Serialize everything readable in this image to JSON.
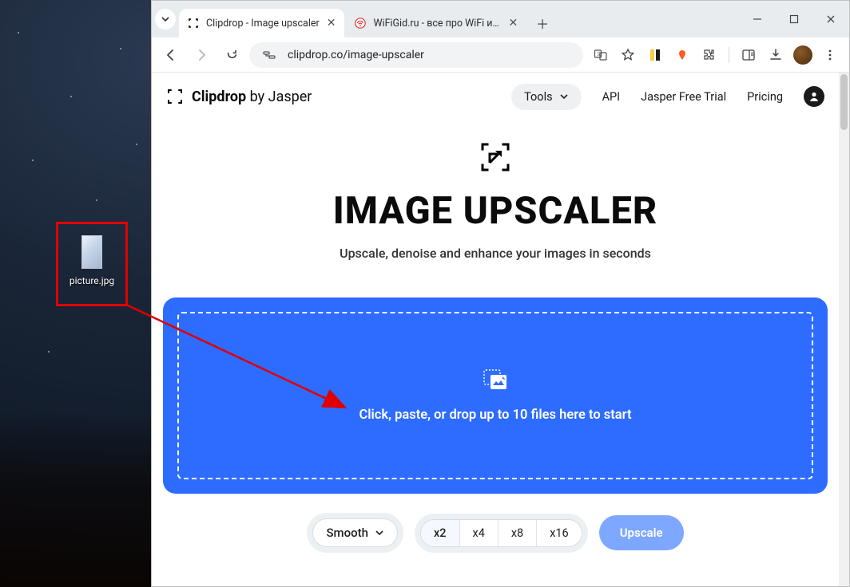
{
  "desktop": {
    "file_name": "picture.jpg"
  },
  "browser": {
    "tabs": [
      {
        "title": "Clipdrop - Image upscaler",
        "active": true
      },
      {
        "title": "WiFiGid.ru - все про WiFi и бес",
        "active": false
      }
    ],
    "url": "clipdrop.co/image-upscaler"
  },
  "site": {
    "brand_bold": "Clipdrop",
    "brand_rest": "by Jasper",
    "nav": {
      "tools": "Tools",
      "api": "API",
      "trial": "Jasper Free Trial",
      "pricing": "Pricing"
    }
  },
  "hero": {
    "title": "IMAGE UPSCALER",
    "subtitle": "Upscale, denoise and enhance your images in seconds"
  },
  "dropzone": {
    "text": "Click, paste, or drop up to 10 files here to start"
  },
  "options": {
    "smooth": "Smooth",
    "scales": [
      "x2",
      "x4",
      "x8",
      "x16"
    ],
    "active_scale": "x2",
    "upscale": "Upscale"
  }
}
